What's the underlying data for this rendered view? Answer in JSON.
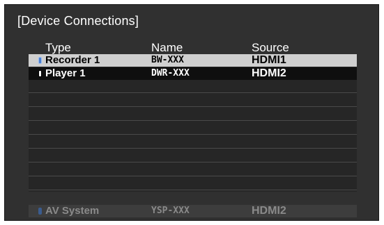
{
  "title": "[Device Connections]",
  "columns": {
    "type": "Type",
    "name": "Name",
    "source": "Source"
  },
  "rows": [
    {
      "type": "Recorder 1",
      "name": "BW-XXX",
      "source": "HDMI1",
      "icon": "blue-device-icon"
    },
    {
      "type": "Player 1",
      "name": "DWR-XXX",
      "source": "HDMI2",
      "icon": "white-device-icon"
    }
  ],
  "empty_rows": 8,
  "footer": {
    "type": "AV System",
    "name": "YSP-XXX",
    "source": "HDMI2",
    "icon": "blue-device-icon"
  },
  "colors": {
    "background": "#303030",
    "selected_row": "#cfcfcf",
    "active_row": "#0f0f0f",
    "icon_blue": "#4a7fd1"
  }
}
